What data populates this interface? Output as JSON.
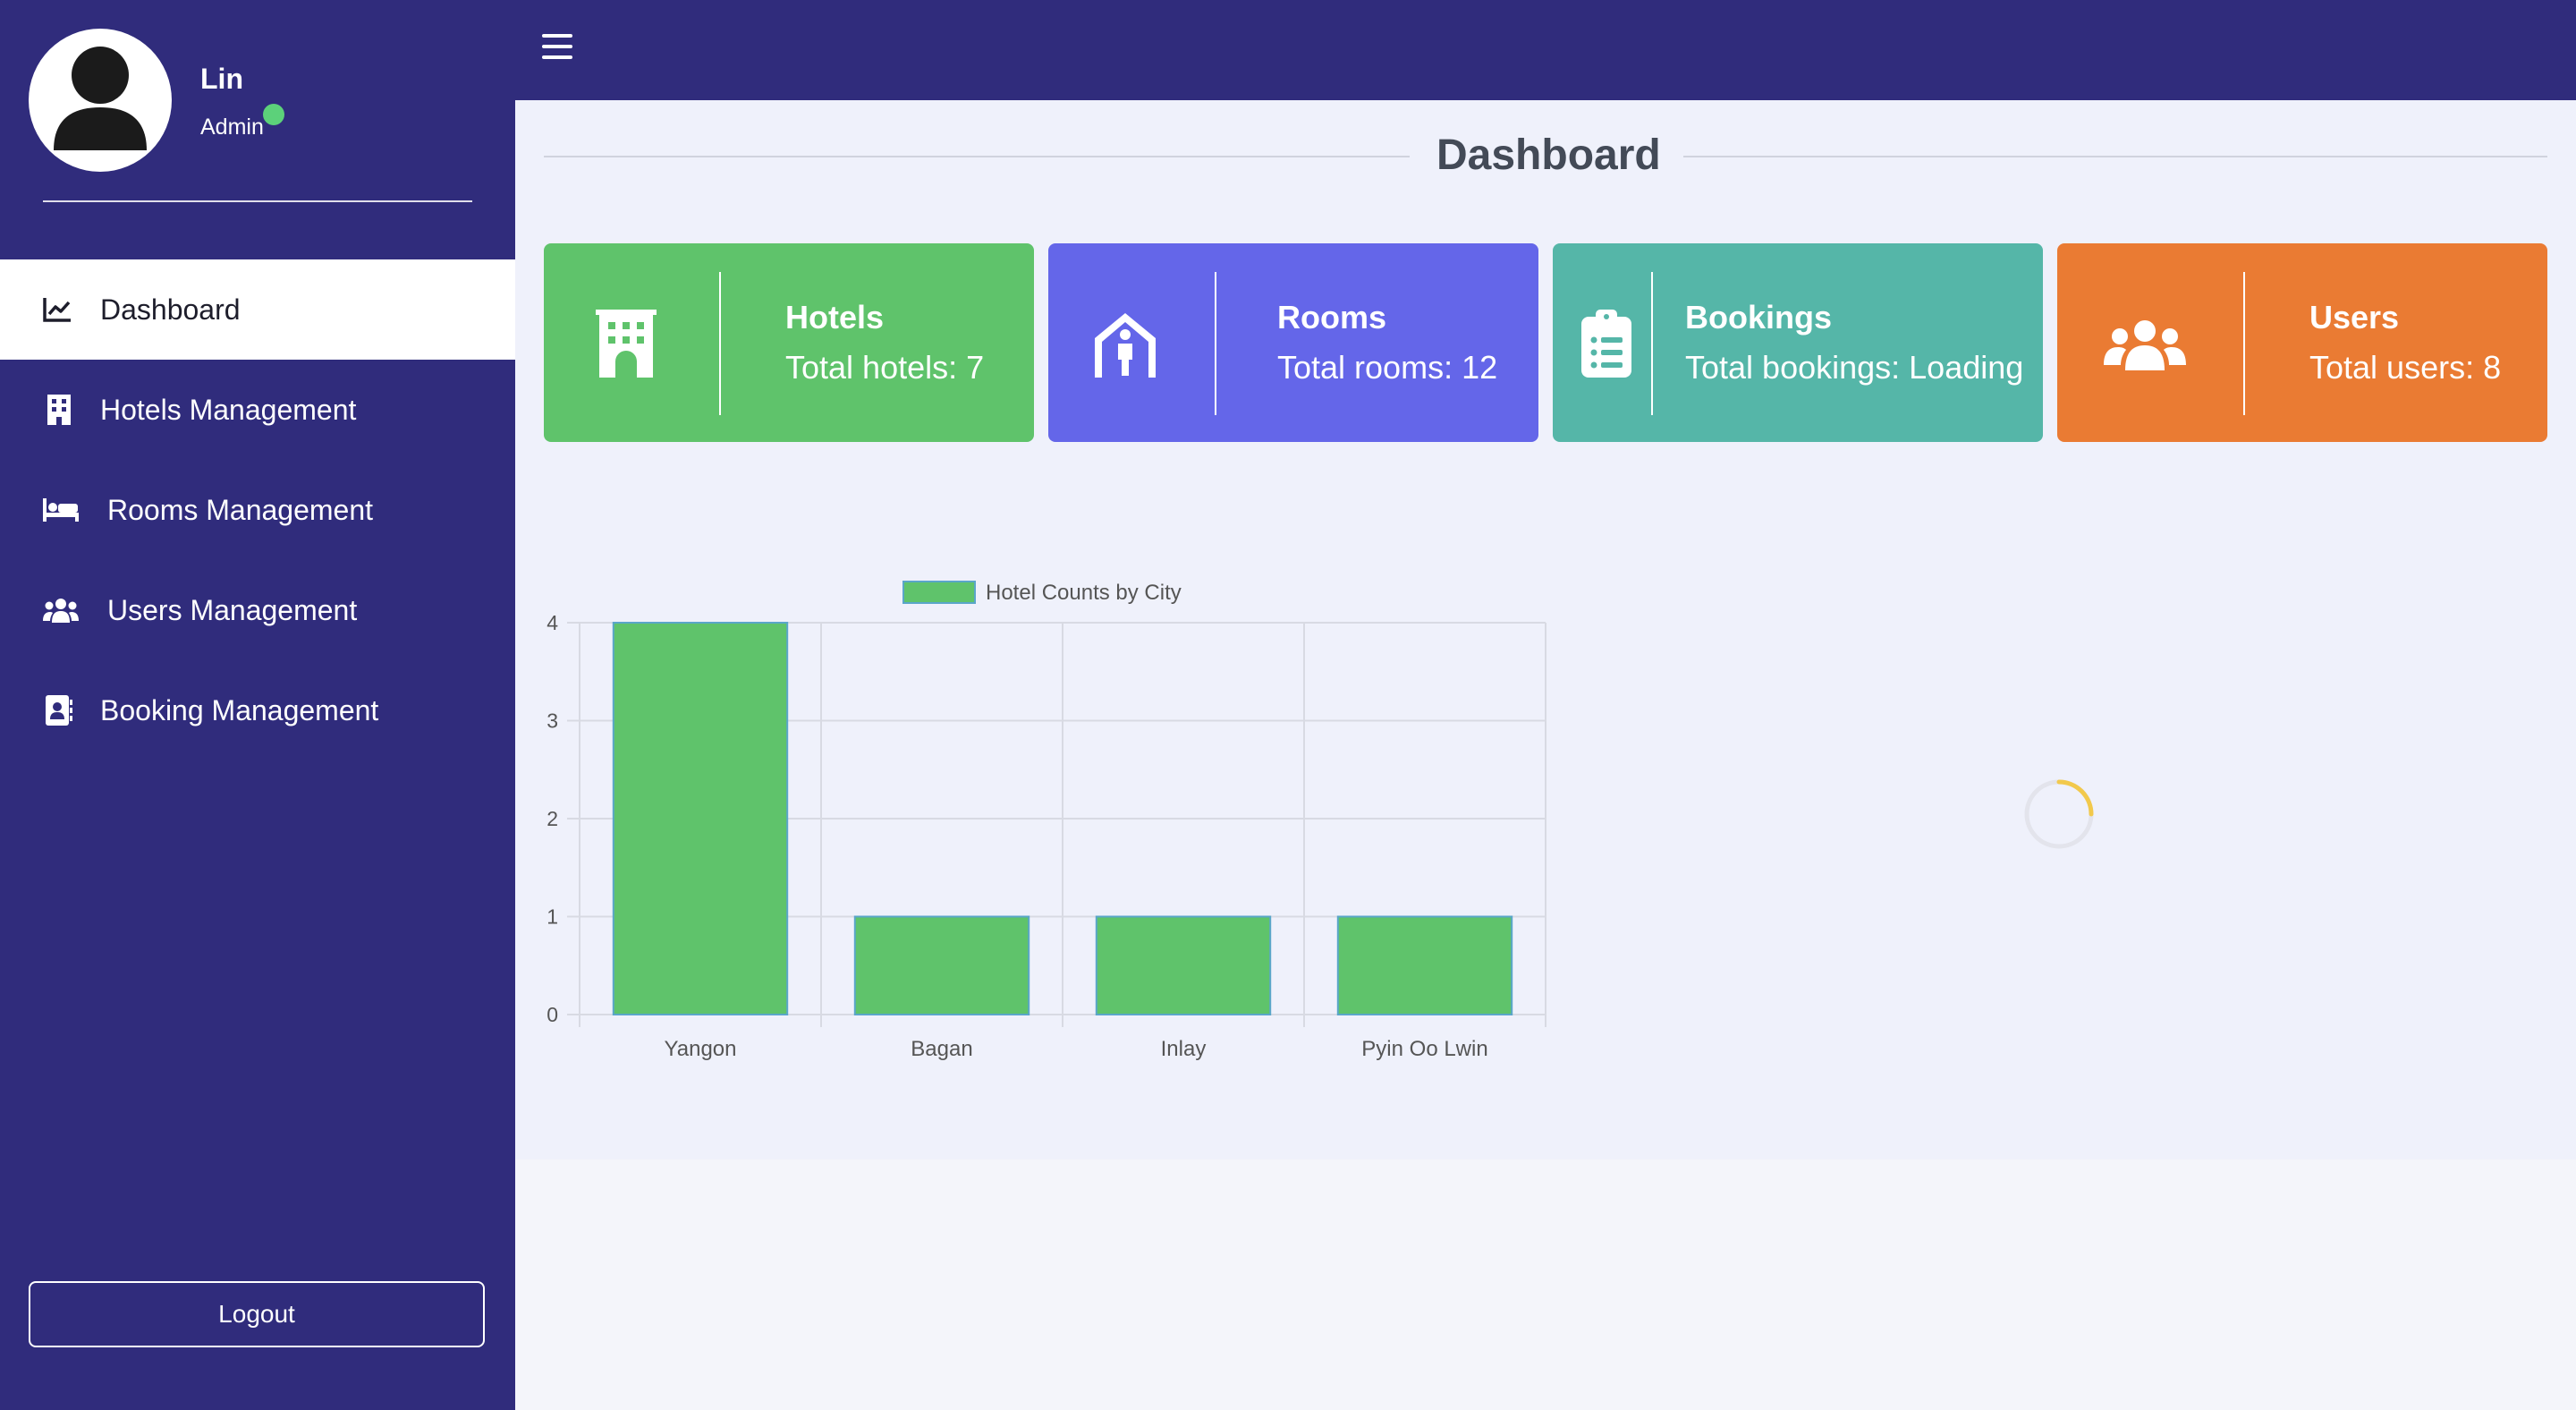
{
  "user": {
    "name": "Lin",
    "role": "Admin"
  },
  "sidebar": {
    "items": [
      {
        "label": "Dashboard",
        "icon": "line-chart-icon",
        "active": true
      },
      {
        "label": "Hotels Management",
        "icon": "building-icon"
      },
      {
        "label": "Rooms Management",
        "icon": "bed-icon"
      },
      {
        "label": "Users Management",
        "icon": "users-icon"
      },
      {
        "label": "Booking Management",
        "icon": "address-book-icon"
      }
    ],
    "logout_label": "Logout"
  },
  "page": {
    "title": "Dashboard"
  },
  "cards": [
    {
      "title": "Hotels",
      "value": "Total hotels: 7",
      "color": "#5fc36b",
      "icon": "hotel-icon"
    },
    {
      "title": "Rooms",
      "value": "Total rooms: 12",
      "color": "#6466e9",
      "icon": "person-booth-icon"
    },
    {
      "title": "Bookings",
      "value": "Total bookings: Loading",
      "color": "#55b6a8",
      "icon": "clipboard-list-icon"
    },
    {
      "title": "Users",
      "value": "Total users: 8",
      "color": "#ea7b33",
      "icon": "users-icon"
    }
  ],
  "colors": {
    "sidebar_bg": "#302c7c",
    "main_bg": "#eff1fb",
    "bar_fill": "#5fc36b",
    "online": "#5cd17a",
    "spinner": "#f2c94c"
  },
  "chart_data": {
    "type": "bar",
    "categories": [
      "Yangon",
      "Bagan",
      "Inlay",
      "Pyin Oo Lwin"
    ],
    "series": [
      {
        "name": "Hotel Counts by City",
        "values": [
          4,
          1,
          1,
          1
        ]
      }
    ],
    "ylim": [
      0,
      4
    ],
    "yticks": [
      0,
      1,
      2,
      3,
      4
    ],
    "grid": true,
    "legend": "top"
  }
}
